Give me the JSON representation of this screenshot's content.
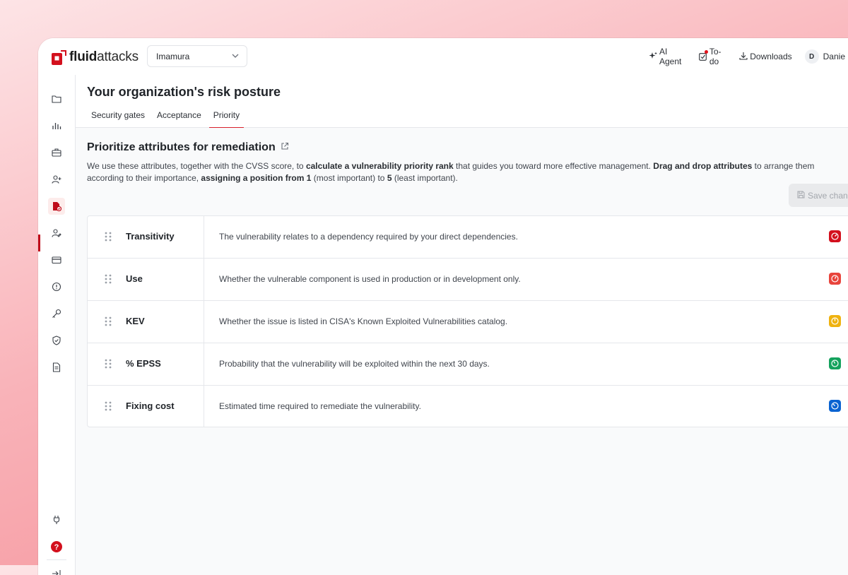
{
  "brand": {
    "logo_bold": "fluid",
    "logo_rest": "attacks",
    "accent": "#d91f2b"
  },
  "org_selector": {
    "value": "Imamura"
  },
  "topbar": {
    "ai_agent": "AI Agent",
    "todo": "To-do",
    "downloads": "Downloads",
    "user_initial": "D",
    "user_name": "Danie"
  },
  "sidebar": {
    "items": [
      {
        "icon": "folder-icon"
      },
      {
        "icon": "bar-chart-icon"
      },
      {
        "icon": "briefcase-icon"
      },
      {
        "icon": "add-user-icon"
      },
      {
        "icon": "policy-document-icon",
        "active": true
      },
      {
        "icon": "user-edit-icon"
      },
      {
        "icon": "credit-card-icon"
      },
      {
        "icon": "alert-circle-icon"
      },
      {
        "icon": "key-icon"
      },
      {
        "icon": "shield-check-icon"
      },
      {
        "icon": "document-icon"
      }
    ],
    "bottom": [
      {
        "icon": "plug-icon"
      },
      {
        "icon": "help-icon"
      },
      {
        "icon": "expand-sidebar-icon"
      }
    ]
  },
  "page": {
    "title": "Your organization's risk posture",
    "tabs": [
      "Security gates",
      "Acceptance",
      "Priority"
    ],
    "selected_tab": "Priority"
  },
  "section": {
    "title": "Prioritize attributes for remediation",
    "desc": {
      "p1": "We use these attributes, together with the CVSS score, to ",
      "b1": "calculate a vulnerability priority rank",
      "p2": " that guides you toward more effective management. ",
      "b2": "Drag and drop attributes",
      "p3": " to arrange them according to their importance, ",
      "b3": "assigning a position from 1",
      "p4": " (most important) to ",
      "b4": "5",
      "p5": " (least important)."
    },
    "save_button": "Save chang"
  },
  "attributes": [
    {
      "name": "Transitivity",
      "description": "The vulnerability relates to a dependency required by your direct dependencies.",
      "badge_color": "#d3101d"
    },
    {
      "name": "Use",
      "description": "Whether the vulnerable component is used in production or in development only.",
      "badge_color": "#e8443c"
    },
    {
      "name": "KEV",
      "description": "Whether the issue is listed in CISA's Known Exploited Vulnerabilities catalog.",
      "badge_color": "#efb20f"
    },
    {
      "name": "% EPSS",
      "description": "Probability that the vulnerability will be exploited within the next 30 days.",
      "badge_color": "#14a25d"
    },
    {
      "name": "Fixing cost",
      "description": "Estimated time required to remediate the vulnerability.",
      "badge_color": "#0a63d1"
    }
  ]
}
